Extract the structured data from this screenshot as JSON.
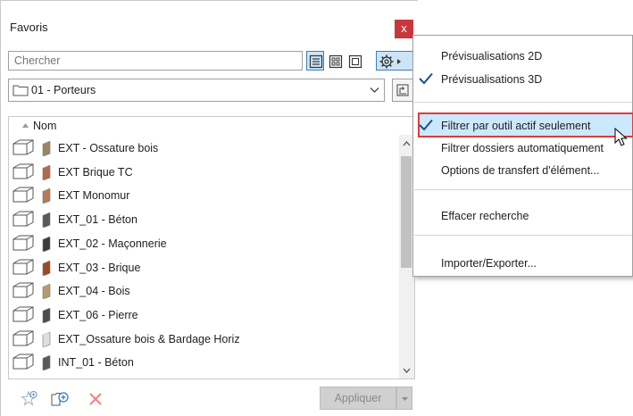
{
  "panel": {
    "title": "Favoris",
    "close_label": "x",
    "search_placeholder": "Chercher",
    "folder": "01 - Porteurs",
    "column_name": "Nom",
    "apply_label": "Appliquer"
  },
  "favorites": [
    {
      "name": "EXT - Ossature bois",
      "color": "#9c8464"
    },
    {
      "name": "EXT Brique TC",
      "color": "#b26a4e"
    },
    {
      "name": "EXT Monomur",
      "color": "#b67a56"
    },
    {
      "name": "EXT_01 - Béton",
      "color": "#5a5a5a"
    },
    {
      "name": "EXT_02 - Maçonnerie",
      "color": "#3c3c3c"
    },
    {
      "name": "EXT_03 - Brique",
      "color": "#9a4a24"
    },
    {
      "name": "EXT_04 - Bois",
      "color": "#b59a6e"
    },
    {
      "name": "EXT_06 - Pierre",
      "color": "#4c4c4c"
    },
    {
      "name": "EXT_Ossature bois & Bardage Horiz",
      "color": "#dedede"
    },
    {
      "name": "INT_01 - Béton",
      "color": "#595959"
    }
  ],
  "menu": {
    "preview_2d": "Prévisualisations 2D",
    "preview_3d": "Prévisualisations 3D",
    "filter_active_tool": "Filtrer par outil actif seulement",
    "filter_folders_auto": "Filtrer dossiers automatiquement",
    "transfer_options": "Options de transfert d'élément...",
    "clear_search": "Effacer recherche",
    "import_export": "Importer/Exporter..."
  },
  "colors": {
    "accent": "#3c7fb1",
    "close": "#c8373b",
    "highlight": "#cce8ff",
    "callout": "#e13a3a"
  }
}
